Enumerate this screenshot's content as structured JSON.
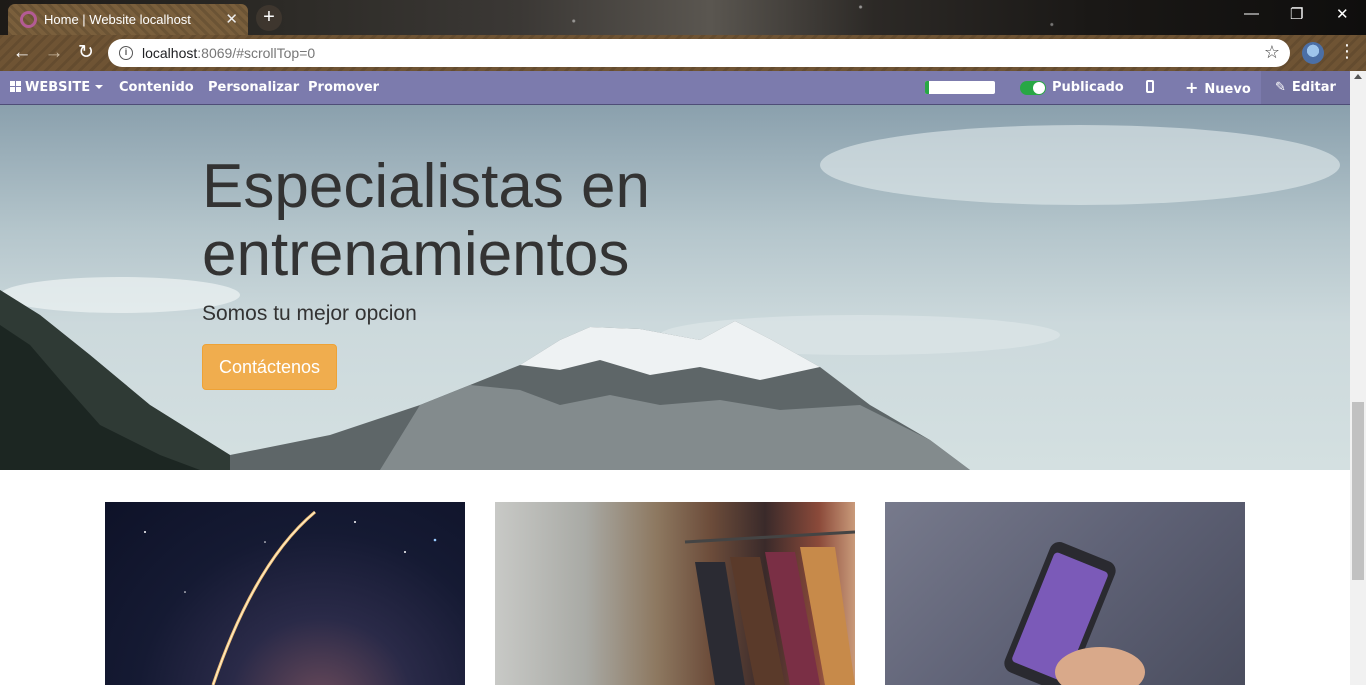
{
  "browser": {
    "tab_title": "Home | Website localhost",
    "tab_close": "✕",
    "new_tab": "+",
    "url_host": "localhost",
    "url_rest": ":8069/#scrollTop=0",
    "window_minimize": "—",
    "window_restore": "❐",
    "window_close": "✕"
  },
  "website_bar": {
    "menu_label": "WEBSITE",
    "content": "Contenido",
    "customize": "Personalizar",
    "promote": "Promover",
    "seo_progress": 0.05,
    "published_label": "Publicado",
    "published": true,
    "new_label": "Nuevo",
    "edit_label": "Editar",
    "colors": {
      "bar": "#7c7bad",
      "toggle_on": "#28a745"
    }
  },
  "hero": {
    "title": "Especialistas en entrenamientos",
    "subtitle": "Somos tu mejor opcion",
    "button_label": "Contáctenos",
    "colors": {
      "button": "#f0ad4e"
    }
  },
  "cards": [
    {
      "image": "rocket-launch-night-sky"
    },
    {
      "image": "clothes-rack-hangers"
    },
    {
      "image": "hand-holding-smartphone"
    }
  ],
  "icons": {
    "back": "back-arrow-icon",
    "forward": "forward-arrow-icon",
    "reload": "reload-icon",
    "info": "info-icon",
    "star": "star-icon",
    "apps": "apps-grid-icon",
    "mobile": "mobile-icon",
    "plus": "plus-icon",
    "pencil": "pencil-icon"
  }
}
